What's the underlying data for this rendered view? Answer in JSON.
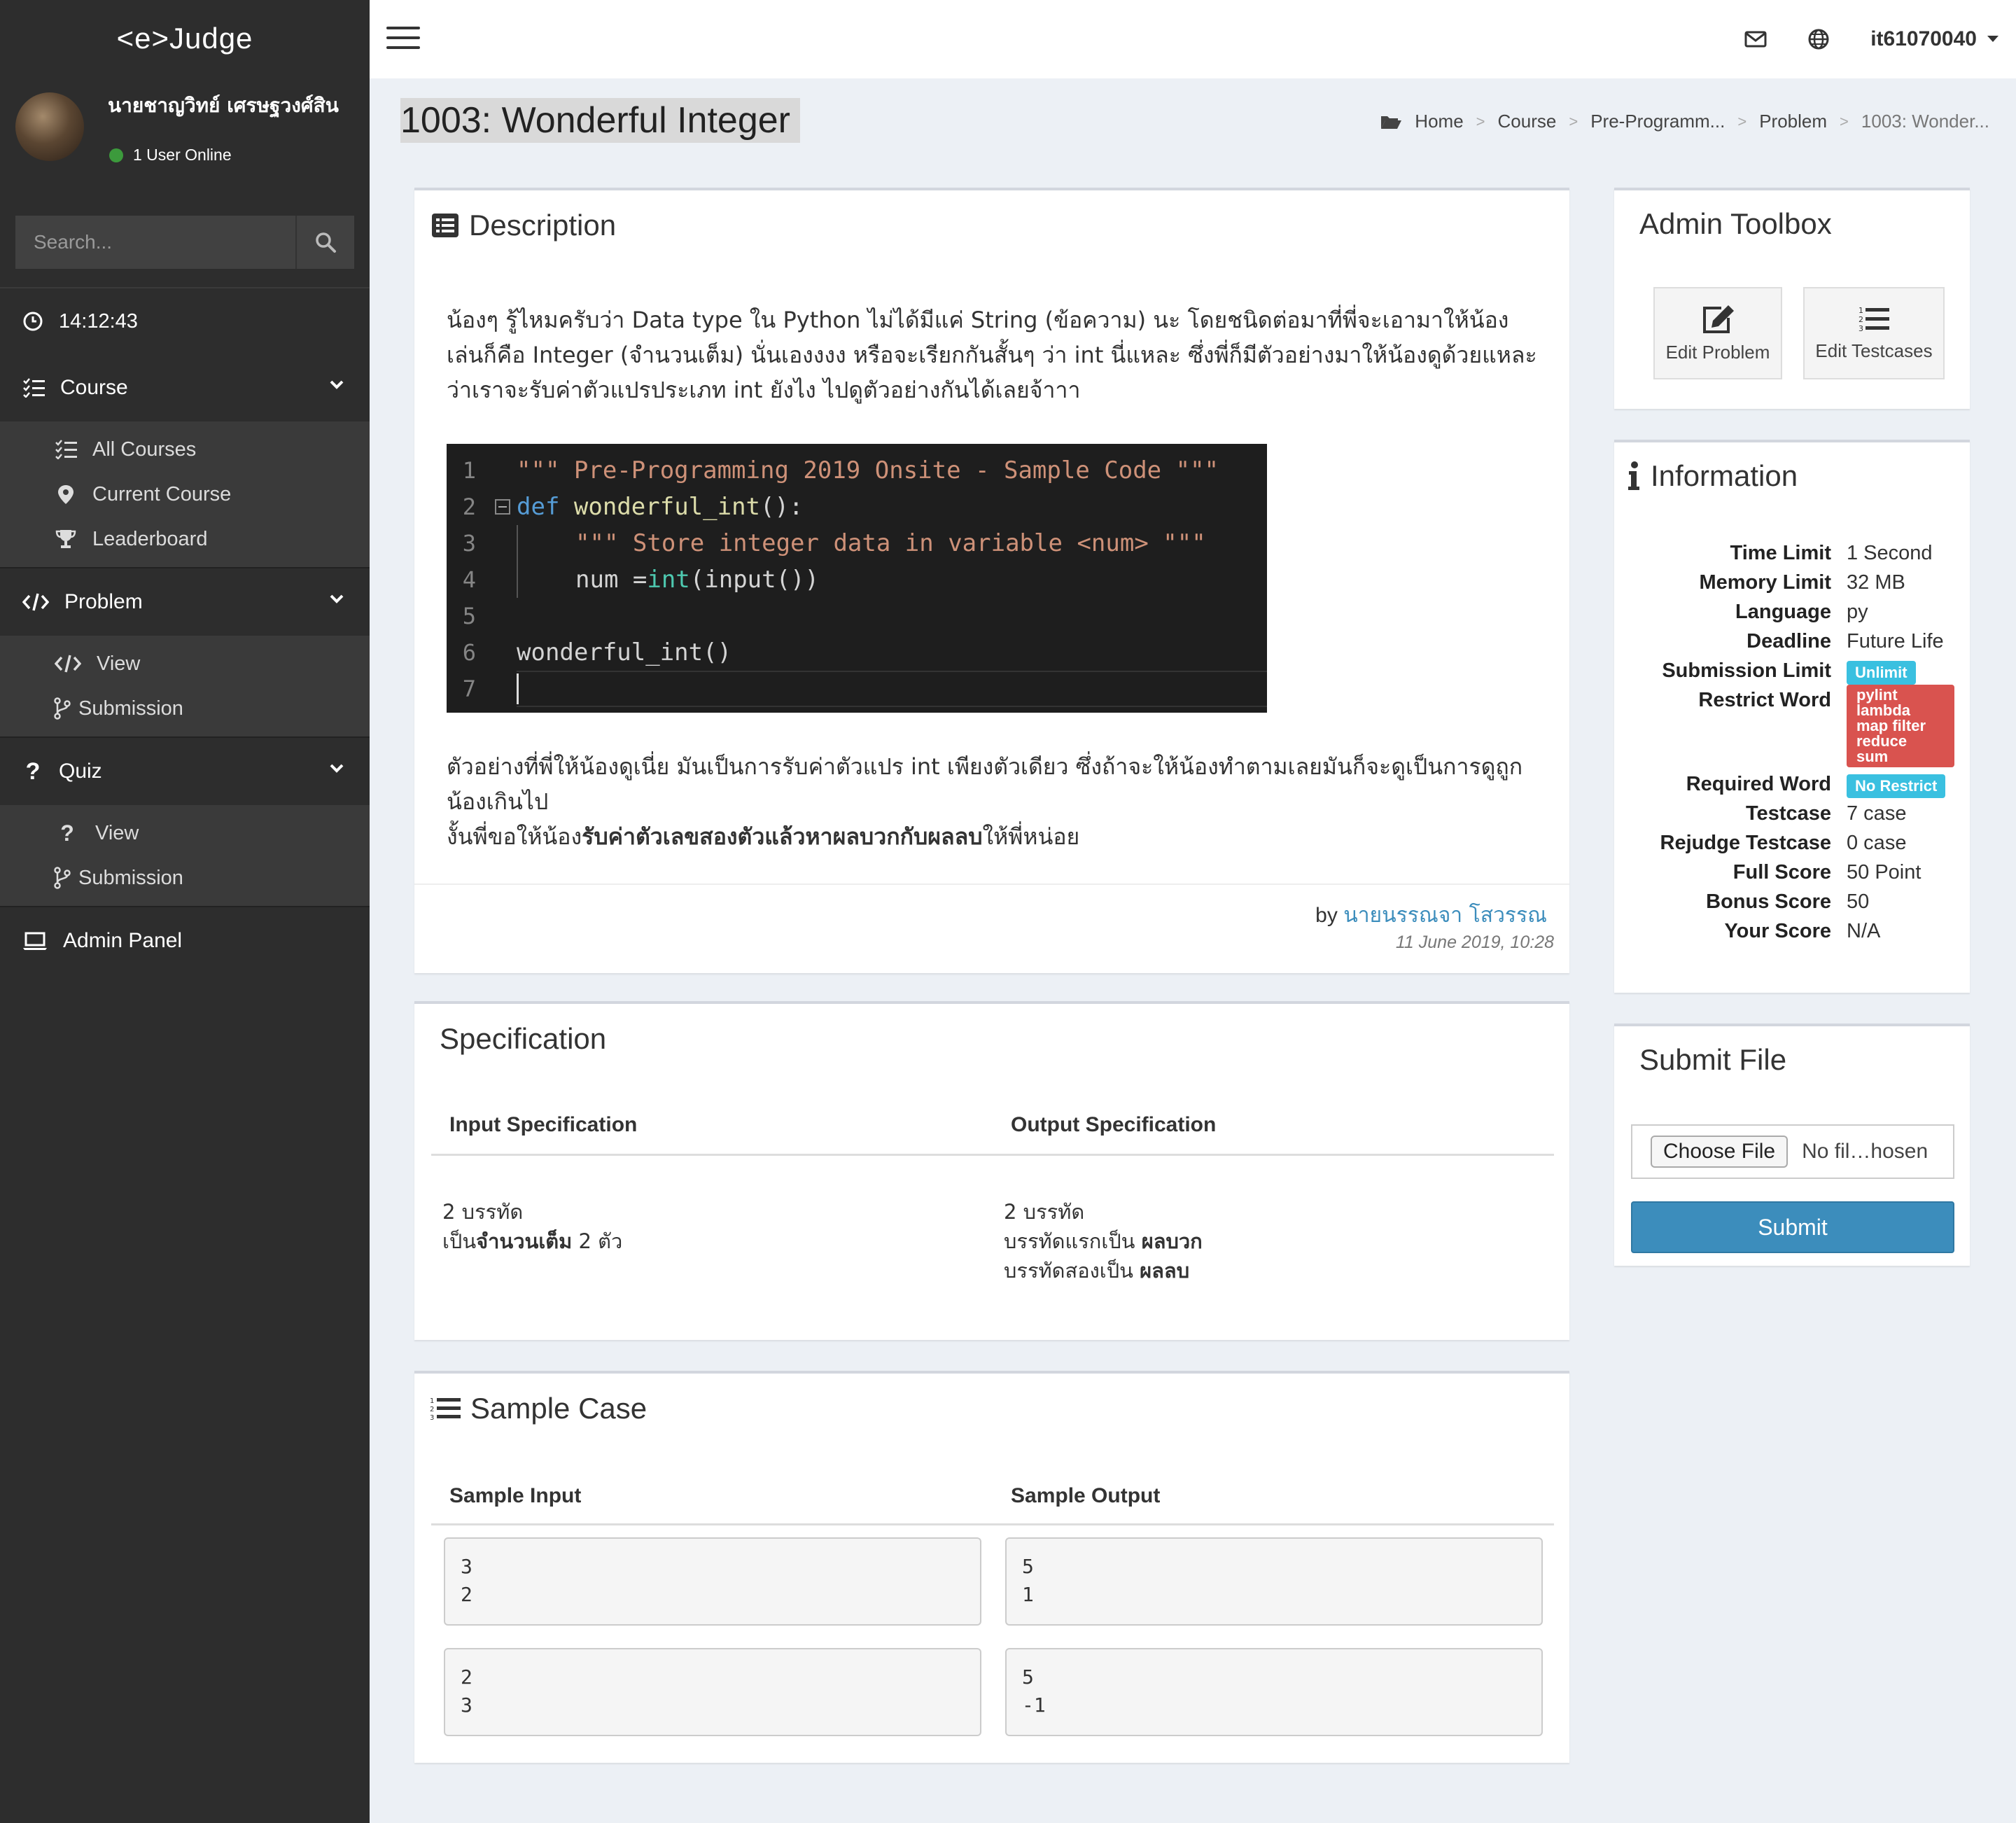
{
  "brand": "<e>Judge",
  "user": {
    "name": "นายชาญวิทย์ เศรษฐวงศ์สิน",
    "status": "1 User Online"
  },
  "search": {
    "placeholder": "Search..."
  },
  "clock": "14:12:43",
  "menu": {
    "course": {
      "label": "Course",
      "items": [
        "All Courses",
        "Current Course",
        "Leaderboard"
      ]
    },
    "problem": {
      "label": "Problem",
      "items": [
        "View",
        "Submission"
      ]
    },
    "quiz": {
      "label": "Quiz",
      "items": [
        "View",
        "Submission"
      ]
    },
    "admin": "Admin Panel"
  },
  "topbar": {
    "username": "it61070040"
  },
  "page": {
    "title": "1003: Wonderful Integer"
  },
  "breadcrumb": [
    "Home",
    "Course",
    "Pre-Programm...",
    "Problem",
    "1003: Wonder..."
  ],
  "description": {
    "title": "Description",
    "paragraph1": "น้องๆ รู้ไหมครับว่า Data type ใน Python ไม่ได้มีแค่ String (ข้อความ) นะ โดยชนิดต่อมาที่พี่จะเอามาให้น้องเล่นก็คือ Integer (จำนวนเต็ม) นั่นเองงงง หรือจะเรียกกันสั้นๆ ว่า int นี่แหละ ซึ่งพี่ก็มีตัวอย่างมาให้น้องดูด้วยแหละว่าเราจะรับค่าตัวแปรประเภท int ยังไง ไปดูตัวอย่างกันได้เลยจ้าาา",
    "code": {
      "line_numbers": [
        "1",
        "2",
        "3",
        "4",
        "5",
        "6",
        "7"
      ],
      "l1": "\"\"\" Pre-Programming 2019 Onsite - Sample Code \"\"\"",
      "l2_kw": "def",
      "l2_fn": "wonderful_int",
      "l2_rest": "():",
      "l3": "\"\"\" Store integer data in variable <num> \"\"\"",
      "l4_var": "num = ",
      "l4_fn": "int",
      "l4_rest": "(input())",
      "l6": "wonderful_int()"
    },
    "paragraph2": "ตัวอย่างที่พี่ให้น้องดูเนี่ย มันเป็นการรับค่าตัวแปร int เพียงตัวเดียว ซึ่งถ้าจะให้น้องทำตามเลยมันก็จะดูเป็นการดูถูกน้องเกินไป",
    "paragraph3_pre": "งั้นพี่ขอให้น้อง",
    "paragraph3_bold": "รับค่าตัวเลขสองตัวแล้วหาผลบวกกับผลลบ",
    "paragraph3_post": "ให้พี่หน่อย",
    "by": "by",
    "author": "นายนรรณจา โสวรรณ",
    "date": "11 June 2019, 10:28"
  },
  "specification": {
    "title": "Specification",
    "input_head": "Input Specification",
    "output_head": "Output Specification",
    "input_line1": "2 บรรทัด",
    "input_line2_pre": "เป็น",
    "input_line2_bold": "จำนวนเต็ม",
    "input_line2_post": " 2 ตัว",
    "output_line1": "2 บรรทัด",
    "output_line2_pre": "บรรทัดแรกเป็น ",
    "output_line2_bold": "ผลบวก",
    "output_line3_pre": "บรรทัดสองเป็น ",
    "output_line3_bold": "ผลลบ"
  },
  "sample": {
    "title": "Sample Case",
    "input_head": "Sample Input",
    "output_head": "Sample Output",
    "cases": [
      {
        "input": "3\n2",
        "output": "5\n1"
      },
      {
        "input": "2\n3",
        "output": "5\n-1"
      }
    ]
  },
  "toolbox": {
    "title": "Admin Toolbox",
    "edit_problem": "Edit Problem",
    "edit_testcases": "Edit Testcases"
  },
  "information": {
    "title": "Information",
    "time_limit": {
      "label": "Time Limit",
      "value": "1 Second"
    },
    "memory_limit": {
      "label": "Memory Limit",
      "value": "32 MB"
    },
    "language": {
      "label": "Language",
      "value": "py"
    },
    "deadline": {
      "label": "Deadline",
      "value": "Future Life"
    },
    "submission_limit": {
      "label": "Submission Limit",
      "value": "Unlimit"
    },
    "restrict_word": {
      "label": "Restrict Word",
      "values": [
        "pylint",
        "lambda",
        "map filter",
        "reduce",
        "sum"
      ]
    },
    "required_word": {
      "label": "Required Word",
      "value": "No Restrict"
    },
    "testcase": {
      "label": "Testcase",
      "value": "7 case"
    },
    "rejudge_testcase": {
      "label": "Rejudge Testcase",
      "value": "0 case"
    },
    "full_score": {
      "label": "Full Score",
      "value": "50 Point"
    },
    "bonus_score": {
      "label": "Bonus Score",
      "value": "50"
    },
    "your_score": {
      "label": "Your Score",
      "value": "N/A"
    }
  },
  "submit": {
    "title": "Submit File",
    "choose": "Choose File",
    "no_file": "No fil…hosen",
    "button": "Submit"
  },
  "colors": {
    "sidebar": "#2d2d2d",
    "primary": "#3c8dbc",
    "badge_blue": "#3ac0e0",
    "badge_red": "#d9534f"
  }
}
